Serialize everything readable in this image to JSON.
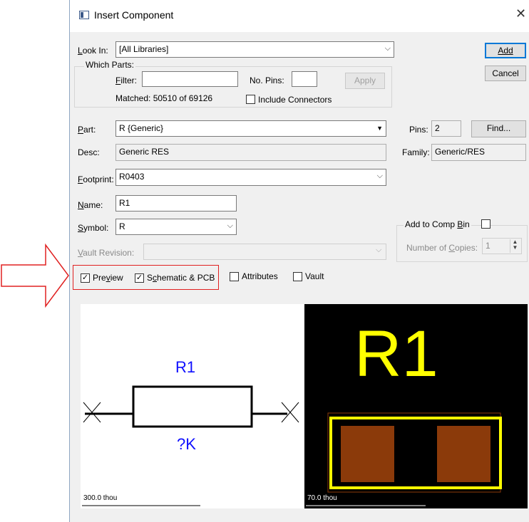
{
  "dialog": {
    "title": "Insert Component"
  },
  "look_in": {
    "label": "Look In:",
    "value": "[All Libraries]"
  },
  "which_parts": {
    "group_label": "Which Parts:",
    "filter_label": "Filter:",
    "filter_value": "",
    "pins_label": "No. Pins:",
    "pins_value": "",
    "apply_label": "Apply",
    "matched_text": "Matched: 50510 of 69126",
    "include_connectors_label": "Include Connectors",
    "include_connectors_checked": false
  },
  "buttons": {
    "add": "Add",
    "cancel": "Cancel",
    "find": "Find..."
  },
  "part": {
    "label": "Part:",
    "value": "R {Generic}"
  },
  "pins": {
    "label": "Pins:",
    "value": "2"
  },
  "desc": {
    "label": "Desc:",
    "value": "Generic RES"
  },
  "family": {
    "label": "Family:",
    "value": "Generic/RES"
  },
  "footprint": {
    "label": "Footprint:",
    "value": "R0403"
  },
  "name": {
    "label": "Name:",
    "value": "R1"
  },
  "symbol": {
    "label": "Symbol:",
    "value": "R"
  },
  "comp_bin": {
    "label": "Add to Comp Bin",
    "checked": false,
    "copies_label": "Number of Copies:",
    "copies_value": "1"
  },
  "vault_revision": {
    "label": "Vault Revision:",
    "value": ""
  },
  "options": {
    "preview_label": "Preview",
    "preview_checked": true,
    "schematic_pcb_label": "Schematic & PCB",
    "schematic_pcb_checked": true,
    "attributes_label": "Attributes",
    "attributes_checked": false,
    "vault_label": "Vault",
    "vault_checked": false
  },
  "schematic_preview": {
    "designator": "R1",
    "value": "?K",
    "scale": "300.0 thou"
  },
  "pcb_preview": {
    "designator": "R1",
    "scale": "70.0 thou"
  },
  "colors": {
    "annotation_red": "#e02020",
    "schematic_text": "#1010ff",
    "pcb_silk": "#ffff00",
    "pcb_pad": "#8b3a0a",
    "dialog_bg": "#f0f0f0"
  }
}
